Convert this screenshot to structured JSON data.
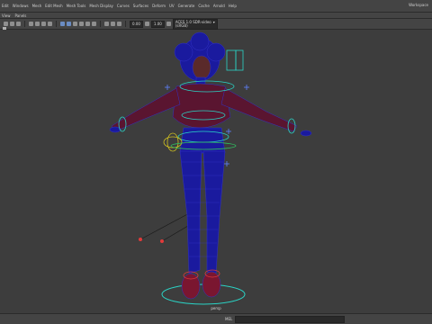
{
  "menubar": {
    "items": [
      "Edit",
      "Windows",
      "Mesh",
      "Edit Mesh",
      "Mesh Tools",
      "Mesh Display",
      "Curves",
      "Surfaces",
      "Deform",
      "UV",
      "Generate",
      "Cache",
      "Arnold",
      "Help"
    ],
    "workspace_label": "Workspace"
  },
  "panel_menu": {
    "items": [
      "View",
      "Panels"
    ]
  },
  "toolbar": {
    "field_1": "0.00",
    "field_2": "1.00",
    "camera_select": "ACES 1.0 SDR-video (sRGB)",
    "camera_arrow": "▾"
  },
  "viewport": {
    "camera_label": "persp"
  },
  "statusbar": {
    "mel_label": "MEL"
  },
  "colors": {
    "viewport_bg": "#3d3d3d",
    "wire": "#1a1a9e",
    "controls": "#2ad4c6",
    "ik": "#e23a3a"
  }
}
